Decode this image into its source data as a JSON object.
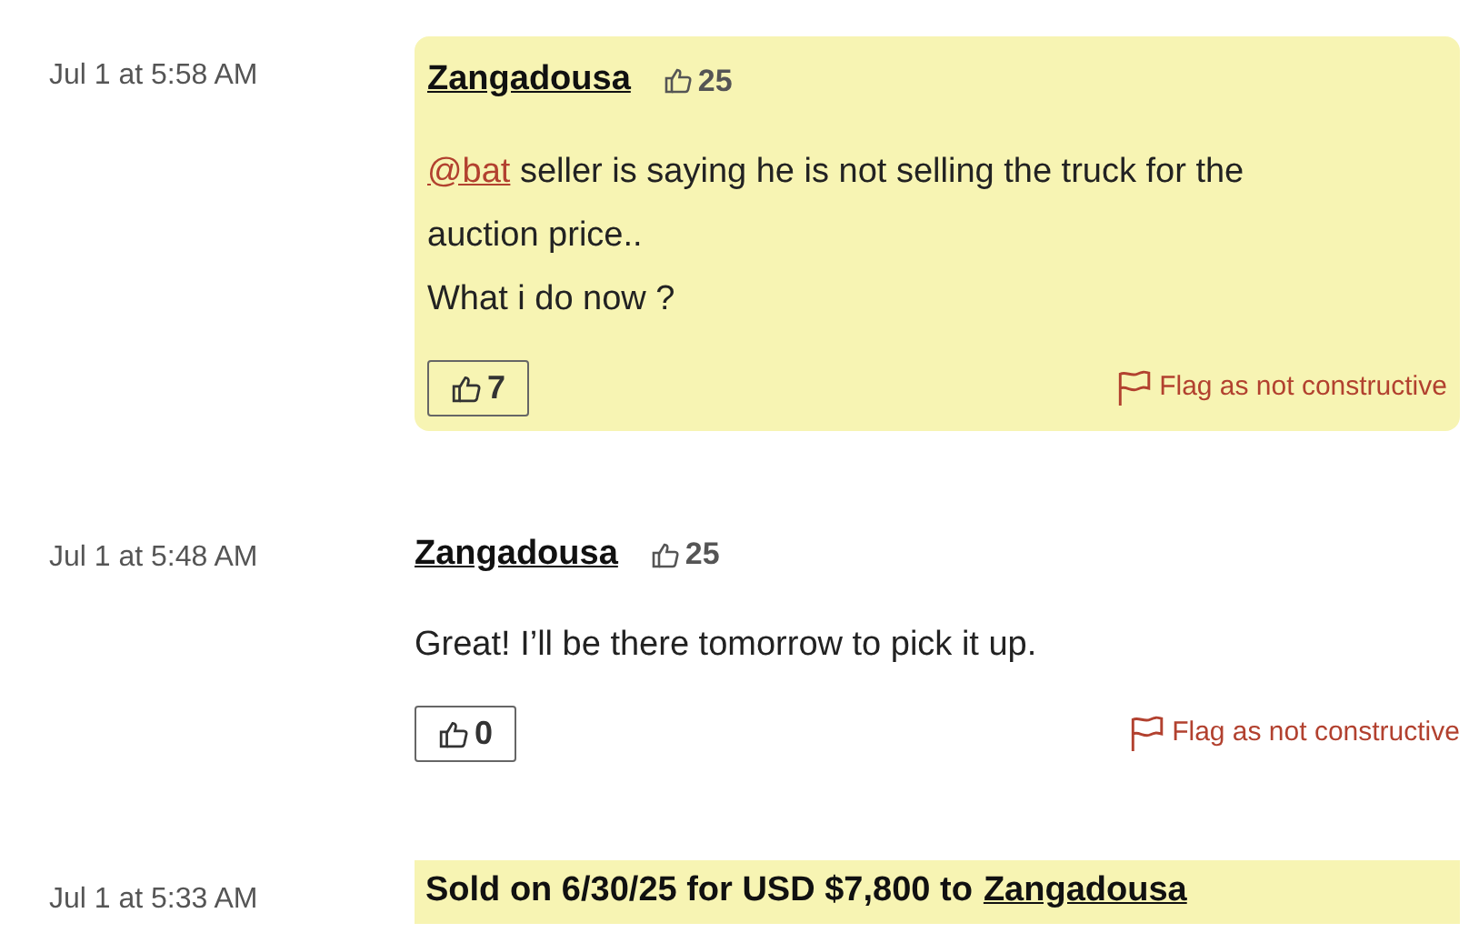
{
  "entries": [
    {
      "kind": "comment",
      "time": "Jul 1 at 5:58 AM",
      "highlighted": true,
      "user": "Zangadousa",
      "reputation": "25",
      "paragraphs": [
        {
          "mention": "@bat",
          "text": "seller is saying he is not selling the truck for the auction price.."
        },
        {
          "text": "What i do now ?"
        }
      ],
      "likes": "7",
      "flag": "Flag as not constructive"
    },
    {
      "kind": "comment",
      "time": "Jul 1 at 5:48 AM",
      "highlighted": false,
      "user": "Zangadousa",
      "reputation": "25",
      "paragraphs": [
        {
          "text": "Great! I’ll be there tomorrow to pick it up."
        }
      ],
      "likes": "0",
      "flag": "Flag as not constructive"
    },
    {
      "kind": "sale",
      "time": "Jul 1 at 5:33 AM",
      "text": "Sold on 6/30/25 for USD $7,800 to",
      "user": "Zangadousa"
    }
  ]
}
